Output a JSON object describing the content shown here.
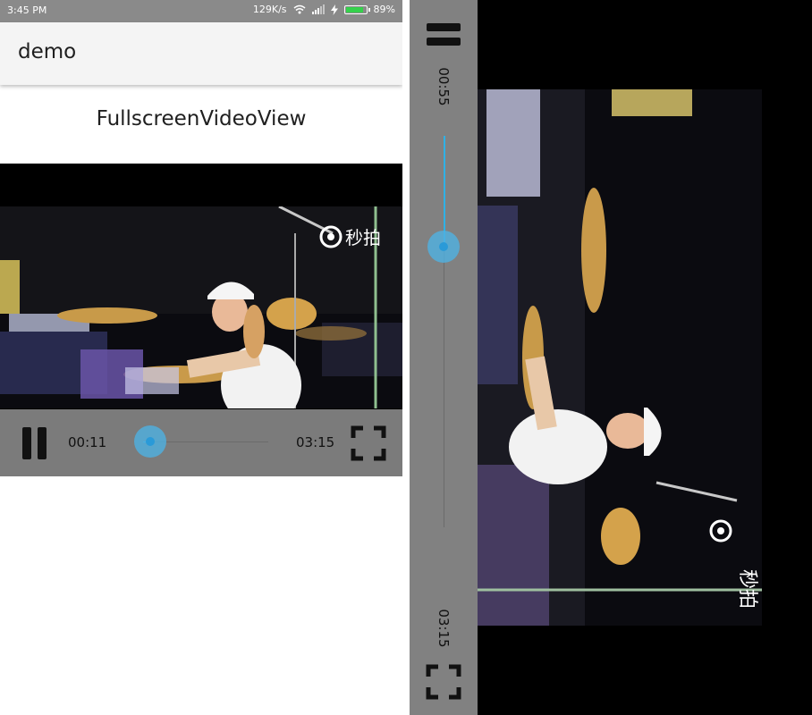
{
  "status_bar": {
    "time": "3:45 PM",
    "network_speed": "129K/s",
    "battery_percent": "89%",
    "battery_level": 0.89,
    "battery_color": "#35d14c"
  },
  "app_bar": {
    "title": "demo"
  },
  "main": {
    "heading": "FullscreenVideoView"
  },
  "inline_player": {
    "current_time": "00:11",
    "total_time": "03:15",
    "progress": 0.056,
    "watermark": "秒拍",
    "pause_icon": "pause-icon",
    "fullscreen_icon": "fullscreen-icon"
  },
  "fullscreen_player": {
    "current_time": "00:55",
    "total_time": "03:15",
    "progress": 0.282,
    "watermark": "秒拍",
    "pause_icon": "pause-icon",
    "fullscreen_icon": "fullscreen-icon"
  },
  "colors": {
    "accent": "#2fb1e6",
    "control_bar": "#969696"
  }
}
